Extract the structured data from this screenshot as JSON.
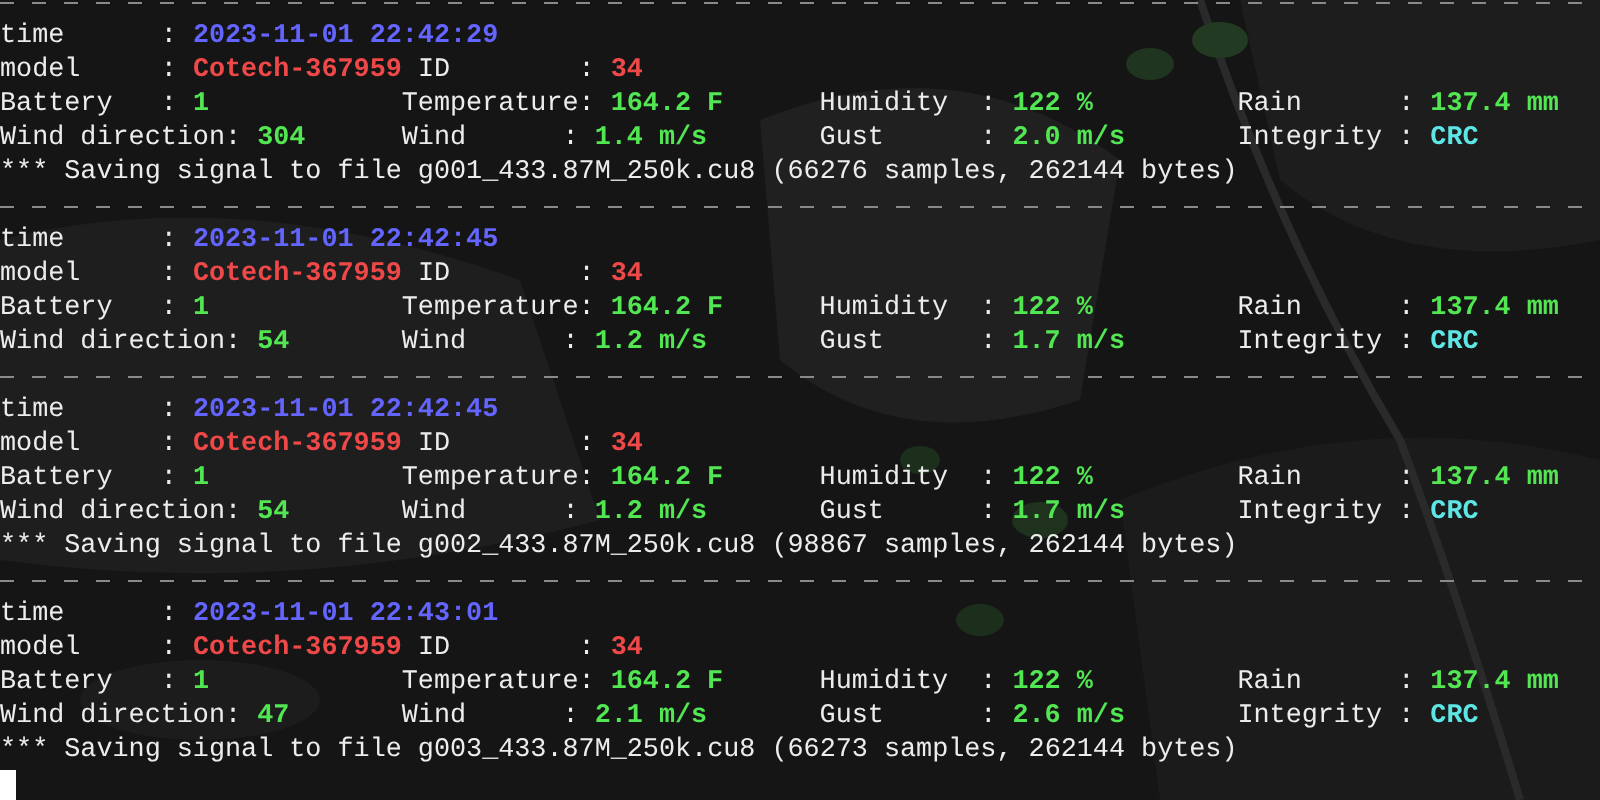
{
  "records": [
    {
      "rows": [
        {
          "fields": [
            {
              "label": "time      :",
              "value": "2023-11-01 22:42:29",
              "kind": "time"
            }
          ]
        },
        {
          "fields": [
            {
              "label": "model     :",
              "value": "Cotech-367959",
              "kind": "model"
            },
            {
              "label": "ID        :",
              "value": "34",
              "kind": "id"
            }
          ]
        },
        {
          "fields": [
            {
              "label": "Battery   :",
              "value": "1",
              "kind": "number"
            },
            {
              "label": "Temperature:",
              "value": "164.2 F",
              "kind": "number"
            },
            {
              "label": "Humidity  :",
              "value": "122 %",
              "kind": "number"
            },
            {
              "label": "Rain      :",
              "value": "137.4 mm",
              "kind": "number"
            }
          ]
        },
        {
          "fields": [
            {
              "label": "Wind direction:",
              "value": "304",
              "kind": "number"
            },
            {
              "label": "Wind      :",
              "value": "1.4 m/s",
              "kind": "number"
            },
            {
              "label": "Gust      :",
              "value": "2.0 m/s",
              "kind": "number"
            },
            {
              "label": "Integrity :",
              "value": "CRC",
              "kind": "check"
            }
          ]
        }
      ],
      "message": "*** Saving signal to file g001_433.87M_250k.cu8 (66276 samples, 262144 bytes)"
    },
    {
      "rows": [
        {
          "fields": [
            {
              "label": "time      :",
              "value": "2023-11-01 22:42:45",
              "kind": "time"
            }
          ]
        },
        {
          "fields": [
            {
              "label": "model     :",
              "value": "Cotech-367959",
              "kind": "model"
            },
            {
              "label": "ID        :",
              "value": "34",
              "kind": "id"
            }
          ]
        },
        {
          "fields": [
            {
              "label": "Battery   :",
              "value": "1",
              "kind": "number"
            },
            {
              "label": "Temperature:",
              "value": "164.2 F",
              "kind": "number"
            },
            {
              "label": "Humidity  :",
              "value": "122 %",
              "kind": "number"
            },
            {
              "label": "Rain      :",
              "value": "137.4 mm",
              "kind": "number"
            }
          ]
        },
        {
          "fields": [
            {
              "label": "Wind direction:",
              "value": "54",
              "kind": "number"
            },
            {
              "label": "Wind      :",
              "value": "1.2 m/s",
              "kind": "number"
            },
            {
              "label": "Gust      :",
              "value": "1.7 m/s",
              "kind": "number"
            },
            {
              "label": "Integrity :",
              "value": "CRC",
              "kind": "check"
            }
          ]
        }
      ]
    },
    {
      "rows": [
        {
          "fields": [
            {
              "label": "time      :",
              "value": "2023-11-01 22:42:45",
              "kind": "time"
            }
          ]
        },
        {
          "fields": [
            {
              "label": "model     :",
              "value": "Cotech-367959",
              "kind": "model"
            },
            {
              "label": "ID        :",
              "value": "34",
              "kind": "id"
            }
          ]
        },
        {
          "fields": [
            {
              "label": "Battery   :",
              "value": "1",
              "kind": "number"
            },
            {
              "label": "Temperature:",
              "value": "164.2 F",
              "kind": "number"
            },
            {
              "label": "Humidity  :",
              "value": "122 %",
              "kind": "number"
            },
            {
              "label": "Rain      :",
              "value": "137.4 mm",
              "kind": "number"
            }
          ]
        },
        {
          "fields": [
            {
              "label": "Wind direction:",
              "value": "54",
              "kind": "number"
            },
            {
              "label": "Wind      :",
              "value": "1.2 m/s",
              "kind": "number"
            },
            {
              "label": "Gust      :",
              "value": "1.7 m/s",
              "kind": "number"
            },
            {
              "label": "Integrity :",
              "value": "CRC",
              "kind": "check"
            }
          ]
        }
      ],
      "message": "*** Saving signal to file g002_433.87M_250k.cu8 (98867 samples, 262144 bytes)"
    },
    {
      "rows": [
        {
          "fields": [
            {
              "label": "time      :",
              "value": "2023-11-01 22:43:01",
              "kind": "time"
            }
          ]
        },
        {
          "fields": [
            {
              "label": "model     :",
              "value": "Cotech-367959",
              "kind": "model"
            },
            {
              "label": "ID        :",
              "value": "34",
              "kind": "id"
            }
          ]
        },
        {
          "fields": [
            {
              "label": "Battery   :",
              "value": "1",
              "kind": "number"
            },
            {
              "label": "Temperature:",
              "value": "164.2 F",
              "kind": "number"
            },
            {
              "label": "Humidity  :",
              "value": "122 %",
              "kind": "number"
            },
            {
              "label": "Rain      :",
              "value": "137.4 mm",
              "kind": "number"
            }
          ]
        },
        {
          "fields": [
            {
              "label": "Wind direction:",
              "value": "47",
              "kind": "number"
            },
            {
              "label": "Wind      :",
              "value": "2.1 m/s",
              "kind": "number"
            },
            {
              "label": "Gust      :",
              "value": "2.6 m/s",
              "kind": "number"
            },
            {
              "label": "Integrity :",
              "value": "CRC",
              "kind": "check"
            }
          ]
        }
      ],
      "message": "*** Saving signal to file g003_433.87M_250k.cu8 (66273 samples, 262144 bytes)"
    }
  ]
}
